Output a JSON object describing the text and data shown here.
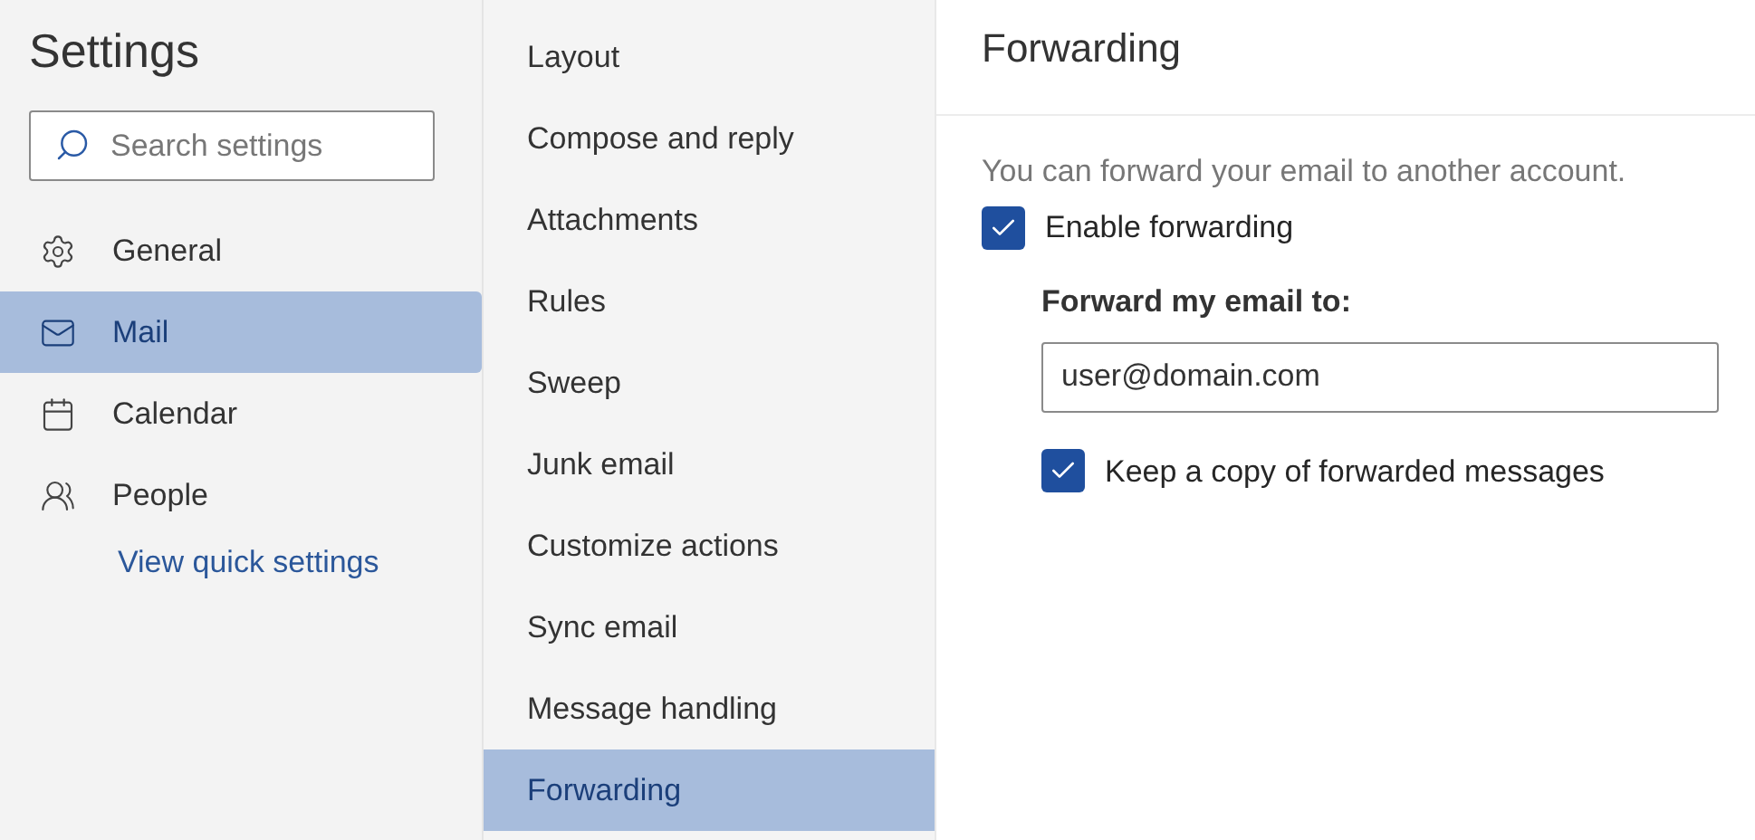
{
  "sidebar": {
    "title": "Settings",
    "search": {
      "placeholder": "Search settings"
    },
    "items": [
      {
        "label": "General",
        "selected": false
      },
      {
        "label": "Mail",
        "selected": true
      },
      {
        "label": "Calendar",
        "selected": false
      },
      {
        "label": "People",
        "selected": false
      }
    ],
    "link": "View quick settings"
  },
  "submenu": {
    "items": [
      {
        "label": "Layout",
        "selected": false
      },
      {
        "label": "Compose and reply",
        "selected": false
      },
      {
        "label": "Attachments",
        "selected": false
      },
      {
        "label": "Rules",
        "selected": false
      },
      {
        "label": "Sweep",
        "selected": false
      },
      {
        "label": "Junk email",
        "selected": false
      },
      {
        "label": "Customize actions",
        "selected": false
      },
      {
        "label": "Sync email",
        "selected": false
      },
      {
        "label": "Message handling",
        "selected": false
      },
      {
        "label": "Forwarding",
        "selected": true
      }
    ]
  },
  "pane": {
    "title": "Forwarding",
    "description": "You can forward your email to another account.",
    "enable": {
      "label": "Enable forwarding",
      "checked": true
    },
    "field_label": "Forward my email to:",
    "address": {
      "value": "user@domain.com"
    },
    "keep_copy": {
      "label": "Keep a copy of forwarded messages",
      "checked": true
    }
  }
}
